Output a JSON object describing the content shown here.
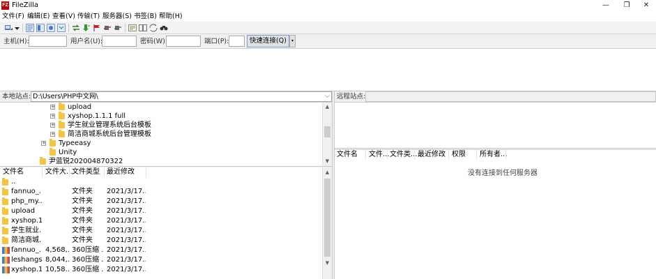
{
  "window": {
    "icon_text": "FZ",
    "title": "FileZilla",
    "minimize": "—",
    "restore": "❐",
    "close": "✕"
  },
  "menu": [
    {
      "label": "文件(F)"
    },
    {
      "label": "编辑(E)"
    },
    {
      "label": "查看(V)"
    },
    {
      "label": "传输(T)"
    },
    {
      "label": "服务器(S)"
    },
    {
      "label": "书签(B)"
    },
    {
      "label": "帮助(H)"
    }
  ],
  "toolbar": {
    "icons": [
      "site-manager-icon",
      "toggle-message-log-icon",
      "toggle-local-tree-icon",
      "toggle-remote-tree-icon",
      "toggle-queue-icon",
      "refresh-icon",
      "process-queue-icon",
      "cancel-icon",
      "disconnect-icon",
      "reconnect-icon",
      "directory-filters-icon",
      "compare-icon",
      "sync-browsing-icon",
      "search-icon"
    ]
  },
  "quickconnect": {
    "host_label": "主机(H):",
    "user_label": "用户名(U):",
    "pass_label": "密码(W):",
    "port_label": "端口(P):",
    "host_value": "",
    "user_value": "",
    "pass_value": "",
    "port_value": "",
    "connect_button": "快速连接(Q)",
    "dropdown": "▾"
  },
  "local": {
    "site_label": "本地站点:",
    "path": "D:\\Users\\PHP中文网\\",
    "tree": [
      {
        "label": "upload",
        "expander": "+"
      },
      {
        "label": "xyshop.1.1.1 full",
        "expander": "+"
      },
      {
        "label": "学生就业管理系统后台模板",
        "expander": "+"
      },
      {
        "label": "简洁商城系统后台管理模板",
        "expander": "+"
      },
      {
        "label": "Typeeasy",
        "expander": "+"
      },
      {
        "label": "Unity",
        "expander": ""
      },
      {
        "label": "尹蓝锐202004870322",
        "expander": ""
      }
    ],
    "columns": [
      "文件名",
      "文件大...",
      "文件类型",
      "最近修改"
    ],
    "sort_indicator": "^",
    "files": [
      {
        "name": "..",
        "size": "",
        "type": "",
        "modified": "",
        "icon": "folder"
      },
      {
        "name": "fannuo_...",
        "size": "",
        "type": "文件夹",
        "modified": "2021/3/17...",
        "icon": "folder"
      },
      {
        "name": "php_my...",
        "size": "",
        "type": "文件夹",
        "modified": "2021/3/17...",
        "icon": "folder"
      },
      {
        "name": "upload",
        "size": "",
        "type": "文件夹",
        "modified": "2021/3/17...",
        "icon": "folder"
      },
      {
        "name": "xyshop.1...",
        "size": "",
        "type": "文件夹",
        "modified": "2021/3/17...",
        "icon": "folder"
      },
      {
        "name": "学生就业...",
        "size": "",
        "type": "文件夹",
        "modified": "2021/3/17...",
        "icon": "folder"
      },
      {
        "name": "简洁商城...",
        "size": "",
        "type": "文件夹",
        "modified": "2021/3/17...",
        "icon": "folder"
      },
      {
        "name": "fannuo_...",
        "size": "4,568,...",
        "type": "360压缩 ...",
        "modified": "2021/3/17...",
        "icon": "zip"
      },
      {
        "name": "leshangs...",
        "size": "8,044,...",
        "type": "360压缩 ...",
        "modified": "2021/3/17...",
        "icon": "zip"
      },
      {
        "name": "xyshop.1...",
        "size": "10,58...",
        "type": "360压缩 ...",
        "modified": "2021/3/17...",
        "icon": "zip"
      }
    ]
  },
  "remote": {
    "site_label": "远程站点:",
    "path": "",
    "columns": [
      "文件名",
      "文件...",
      "文件类...",
      "最近修改",
      "权限",
      "所有者..."
    ],
    "empty_message": "没有连接到任何服务器"
  },
  "colors": {
    "accent": "#7a9cd3",
    "folder": "#f5c542",
    "app_icon": "#bf0000"
  }
}
